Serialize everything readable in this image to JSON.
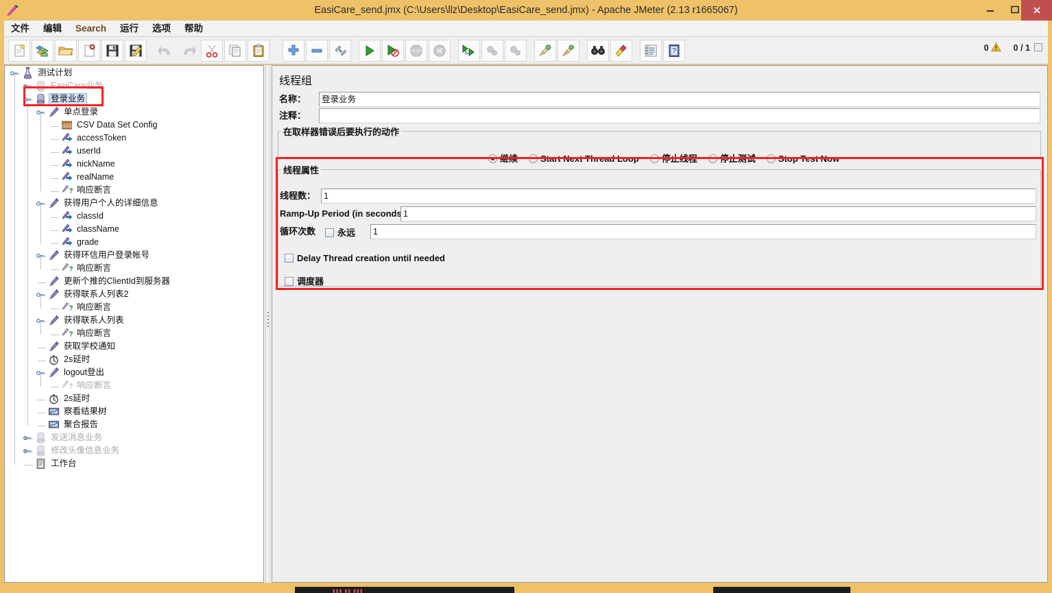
{
  "window": {
    "title": "EasiCare_send.jmx (C:\\Users\\llz\\Desktop\\EasiCare_send.jmx) - Apache JMeter (2.13 r1665067)",
    "icon": "jmeter-feather-icon",
    "minimize_label": "minimize-icon",
    "maximize_label": "maximize-icon",
    "close_label": "close-icon",
    "titlebar_color": "#efc169",
    "close_button_color": "#c0504d"
  },
  "menubar": {
    "items": [
      {
        "label": "文件",
        "name": "menu-file"
      },
      {
        "label": "编辑",
        "name": "menu-edit"
      },
      {
        "label": "Search",
        "name": "menu-search"
      },
      {
        "label": "运行",
        "name": "menu-run"
      },
      {
        "label": "选项",
        "name": "menu-options"
      },
      {
        "label": "帮助",
        "name": "menu-help"
      }
    ]
  },
  "toolbar": {
    "buttons": [
      {
        "name": "new-button",
        "icon": "new-document-icon",
        "enabled": true
      },
      {
        "name": "templates-button",
        "icon": "templates-icon",
        "enabled": true
      },
      {
        "name": "open-button",
        "icon": "open-folder-icon",
        "enabled": true
      },
      {
        "name": "close-button",
        "icon": "close-document-icon",
        "enabled": true
      },
      {
        "name": "save-button",
        "icon": "floppy-disk-icon",
        "enabled": true
      },
      {
        "name": "save-as-button",
        "icon": "save-as-icon",
        "enabled": true
      },
      {
        "name": "undo-button",
        "icon": "undo-arrow-icon",
        "enabled": false
      },
      {
        "name": "redo-button",
        "icon": "redo-arrow-icon",
        "enabled": false
      },
      {
        "name": "cut-button",
        "icon": "scissors-icon",
        "enabled": true
      },
      {
        "name": "copy-button",
        "icon": "copy-pages-icon",
        "enabled": true
      },
      {
        "name": "paste-button",
        "icon": "clipboard-icon",
        "enabled": true
      },
      {
        "name": "expand-all-button",
        "icon": "plus-icon",
        "enabled": true
      },
      {
        "name": "collapse-all-button",
        "icon": "minus-icon",
        "enabled": true
      },
      {
        "name": "toggle-button",
        "icon": "toggle-icon",
        "enabled": true
      },
      {
        "name": "start-button",
        "icon": "play-green-icon",
        "enabled": true
      },
      {
        "name": "start-no-pauses-button",
        "icon": "play-no-pauses-icon",
        "enabled": true
      },
      {
        "name": "stop-button",
        "icon": "stop-sign-icon",
        "enabled": false
      },
      {
        "name": "shutdown-button",
        "icon": "shutdown-x-icon",
        "enabled": false
      },
      {
        "name": "remote-start-all-button",
        "icon": "remote-start-icon",
        "enabled": true
      },
      {
        "name": "remote-stop-all-button",
        "icon": "remote-stop-icon",
        "enabled": false
      },
      {
        "name": "remote-shutdown-all-button",
        "icon": "remote-shutdown-icon",
        "enabled": false
      },
      {
        "name": "clear-button",
        "icon": "broom-green-icon",
        "enabled": true
      },
      {
        "name": "clear-all-button",
        "icon": "broom-all-icon",
        "enabled": true
      },
      {
        "name": "search-button",
        "icon": "binoculars-icon",
        "enabled": true
      },
      {
        "name": "reset-search-button",
        "icon": "yellow-brush-icon",
        "enabled": true
      },
      {
        "name": "function-helper-button",
        "icon": "function-list-icon",
        "enabled": true
      },
      {
        "name": "help-button",
        "icon": "help-book-icon",
        "enabled": true
      }
    ],
    "status": {
      "warning_count": "0",
      "warning_icon": "warning-triangle-icon",
      "thread_counter": "0 / 1"
    }
  },
  "tree": {
    "nodes": [
      {
        "label": "测试计划",
        "icon": "test-plan-icon",
        "depth": 0,
        "handle": "expanded",
        "state": "normal"
      },
      {
        "label": "EasiCare业务",
        "icon": "thread-group-icon",
        "depth": 1,
        "handle": "collapsed",
        "state": "disabled"
      },
      {
        "label": "登录业务",
        "icon": "thread-group-icon",
        "depth": 1,
        "handle": "expanded",
        "state": "selected"
      },
      {
        "label": "单点登录",
        "icon": "http-sampler-icon",
        "depth": 2,
        "handle": "expanded",
        "state": "normal"
      },
      {
        "label": "CSV Data Set Config",
        "icon": "csv-data-set-icon",
        "depth": 3,
        "handle": "none",
        "state": "normal"
      },
      {
        "label": "accessToken",
        "icon": "post-processor-icon",
        "depth": 3,
        "handle": "none",
        "state": "normal"
      },
      {
        "label": "userId",
        "icon": "post-processor-icon",
        "depth": 3,
        "handle": "none",
        "state": "normal"
      },
      {
        "label": "nickName",
        "icon": "post-processor-icon",
        "depth": 3,
        "handle": "none",
        "state": "normal"
      },
      {
        "label": "realName",
        "icon": "post-processor-icon",
        "depth": 3,
        "handle": "none",
        "state": "normal"
      },
      {
        "label": "响应断言",
        "icon": "assertion-icon",
        "depth": 3,
        "handle": "none",
        "state": "normal"
      },
      {
        "label": "获得用户个人的详细信息",
        "icon": "http-sampler-icon",
        "depth": 2,
        "handle": "expanded",
        "state": "normal"
      },
      {
        "label": "classId",
        "icon": "post-processor-icon",
        "depth": 3,
        "handle": "none",
        "state": "normal"
      },
      {
        "label": "className",
        "icon": "post-processor-icon",
        "depth": 3,
        "handle": "none",
        "state": "normal"
      },
      {
        "label": "grade",
        "icon": "post-processor-icon",
        "depth": 3,
        "handle": "none",
        "state": "normal"
      },
      {
        "label": "获得环信用户登录帐号",
        "icon": "http-sampler-icon",
        "depth": 2,
        "handle": "expanded",
        "state": "normal"
      },
      {
        "label": "响应断言",
        "icon": "assertion-icon",
        "depth": 3,
        "handle": "none",
        "state": "normal"
      },
      {
        "label": "更新个推的ClientId到服务器",
        "icon": "http-sampler-icon",
        "depth": 2,
        "handle": "none",
        "state": "normal"
      },
      {
        "label": "获得联系人列表2",
        "icon": "http-sampler-icon",
        "depth": 2,
        "handle": "expanded",
        "state": "normal"
      },
      {
        "label": "响应断言",
        "icon": "assertion-icon",
        "depth": 3,
        "handle": "none",
        "state": "normal"
      },
      {
        "label": "获得联系人列表",
        "icon": "http-sampler-icon",
        "depth": 2,
        "handle": "expanded",
        "state": "normal"
      },
      {
        "label": "响应断言",
        "icon": "assertion-icon",
        "depth": 3,
        "handle": "none",
        "state": "normal"
      },
      {
        "label": "获取学校通知",
        "icon": "http-sampler-icon",
        "depth": 2,
        "handle": "none",
        "state": "normal"
      },
      {
        "label": "2s延时",
        "icon": "timer-icon",
        "depth": 2,
        "handle": "none",
        "state": "normal"
      },
      {
        "label": "logout登出",
        "icon": "http-sampler-icon",
        "depth": 2,
        "handle": "expanded",
        "state": "normal"
      },
      {
        "label": "响应断言",
        "icon": "assertion-icon",
        "depth": 3,
        "handle": "none",
        "state": "disabled"
      },
      {
        "label": "2s延时",
        "icon": "timer-icon",
        "depth": 2,
        "handle": "none",
        "state": "normal"
      },
      {
        "label": "察看结果树",
        "icon": "view-results-tree-icon",
        "depth": 2,
        "handle": "none",
        "state": "normal"
      },
      {
        "label": "聚合报告",
        "icon": "aggregate-report-icon",
        "depth": 2,
        "handle": "none",
        "state": "normal"
      },
      {
        "label": "发送消息业务",
        "icon": "thread-group-icon",
        "depth": 1,
        "handle": "collapsed",
        "state": "disabled"
      },
      {
        "label": "修改头像信息业务",
        "icon": "thread-group-icon",
        "depth": 1,
        "handle": "collapsed",
        "state": "disabled"
      },
      {
        "label": "工作台",
        "icon": "workbench-icon",
        "depth": 1,
        "handle": "none",
        "state": "normal"
      }
    ]
  },
  "panel": {
    "title": "线程组",
    "name_label": "名称：",
    "name_value": "登录业务",
    "comment_label": "注释：",
    "comment_value": "",
    "error_action": {
      "legend": "在取样器错误后要执行的动作",
      "options": [
        {
          "label": "继续",
          "selected": true,
          "name": "radio-continue"
        },
        {
          "label": "Start Next Thread Loop",
          "selected": false,
          "name": "radio-start-next-thread-loop"
        },
        {
          "label": "停止线程",
          "selected": false,
          "name": "radio-stop-thread"
        },
        {
          "label": "停止测试",
          "selected": false,
          "name": "radio-stop-test"
        },
        {
          "label": "Stop Test Now",
          "selected": false,
          "name": "radio-stop-test-now"
        }
      ]
    },
    "thread_properties": {
      "legend": "线程属性",
      "num_threads_label": "线程数：",
      "num_threads_value": "1",
      "ramp_up_label": "Ramp-Up Period (in seconds):",
      "ramp_up_value": "1",
      "loop_count_label": "循环次数",
      "forever_label": "永远",
      "forever_checked": false,
      "loop_count_value": "1",
      "delay_thread_label": "Delay Thread creation until needed",
      "delay_thread_checked": false,
      "scheduler_label": "调度器",
      "scheduler_checked": false
    }
  },
  "annotations": {
    "highlight_color": "#fb2020",
    "boxes": [
      {
        "name": "annotation-box-selected-thread-group"
      },
      {
        "name": "annotation-box-thread-properties"
      }
    ]
  }
}
